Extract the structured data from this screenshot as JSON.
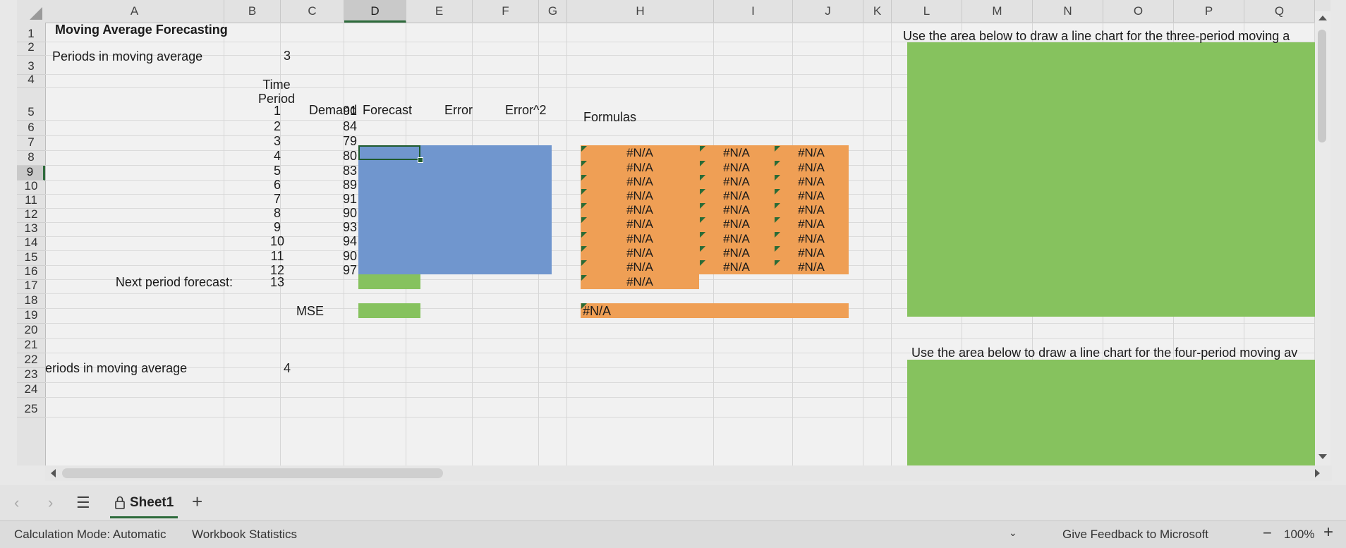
{
  "columns": [
    "A",
    "B",
    "C",
    "D",
    "E",
    "F",
    "G",
    "H",
    "I",
    "J",
    "K",
    "L",
    "M",
    "N",
    "O",
    "P",
    "Q"
  ],
  "selected_column": "D",
  "rows": [
    "1",
    "2",
    "3",
    "4",
    "5",
    "6",
    "7",
    "8",
    "9",
    "10",
    "11",
    "12",
    "13",
    "14",
    "15",
    "16",
    "17",
    "18",
    "19",
    "20",
    "21",
    "22",
    "23",
    "24",
    "25"
  ],
  "selected_row": "9",
  "cells": {
    "title": "Moving Average Forecasting",
    "periods_label": "Periods in moving average",
    "periods_value": "3",
    "hdr_time_period": "Time Period",
    "hdr_demand": "Demand",
    "hdr_forecast": "Forecast",
    "hdr_error": "Error",
    "hdr_error_sq": "Error^2",
    "hdr_formulas": "Formulas",
    "next_forecast_label": "Next period forecast:",
    "next_forecast_value": "13",
    "mse_label": "MSE",
    "periods2_label": "Periods in moving average",
    "periods2_value": "4",
    "chart_note_1": "Use the area below to draw a line chart for the three-period moving a",
    "chart_note_2": "Use the area below to draw a line chart for the four-period moving av"
  },
  "table": [
    {
      "period": "1",
      "demand": "91"
    },
    {
      "period": "2",
      "demand": "84"
    },
    {
      "period": "3",
      "demand": "79"
    },
    {
      "period": "4",
      "demand": "80"
    },
    {
      "period": "5",
      "demand": "83"
    },
    {
      "period": "6",
      "demand": "89"
    },
    {
      "period": "7",
      "demand": "91"
    },
    {
      "period": "8",
      "demand": "90"
    },
    {
      "period": "9",
      "demand": "93"
    },
    {
      "period": "10",
      "demand": "94"
    },
    {
      "period": "11",
      "demand": "90"
    },
    {
      "period": "12",
      "demand": "97"
    }
  ],
  "error_value": "#N/A",
  "mse_formula_value": "#N/A",
  "sheet_tab": "Sheet1",
  "status": {
    "calc_mode": "Calculation Mode: Automatic",
    "workbook_stats": "Workbook Statistics",
    "feedback": "Give Feedback to Microsoft",
    "zoom": "100%"
  },
  "colors": {
    "blue_fill": "#7096ce",
    "orange_fill": "#ef9f55",
    "green_fill": "#86c25e",
    "selection": "#1e5a2e"
  }
}
